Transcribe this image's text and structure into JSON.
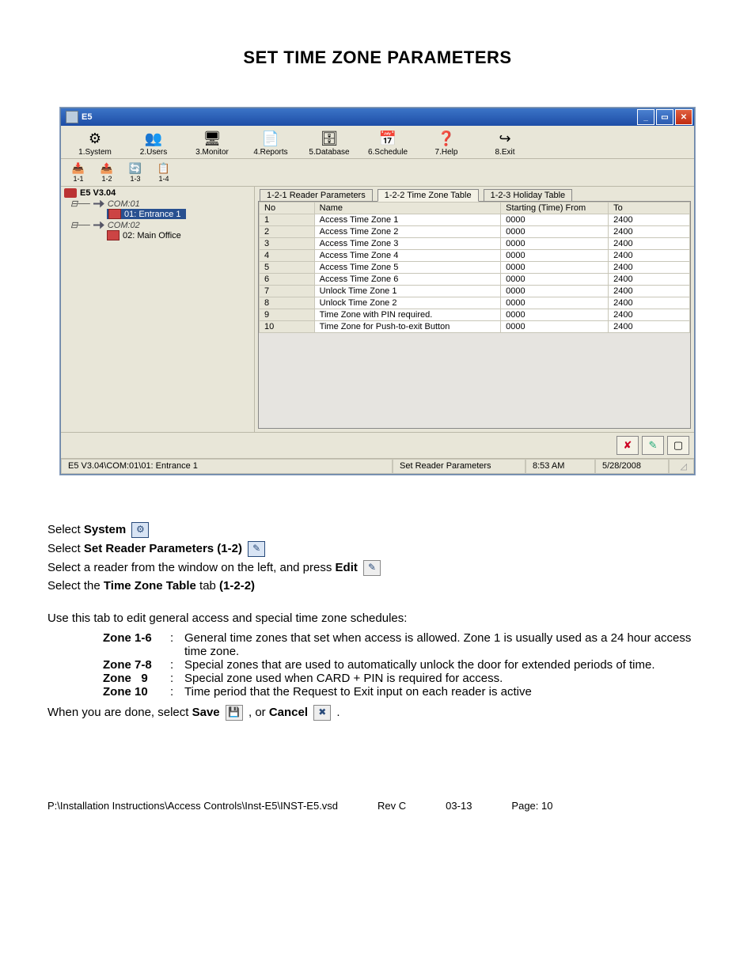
{
  "page_title": "SET TIME ZONE PARAMETERS",
  "window": {
    "title": "E5",
    "menu_items": [
      {
        "label": "1.System"
      },
      {
        "label": "2.Users"
      },
      {
        "label": "3.Monitor"
      },
      {
        "label": "4.Reports"
      },
      {
        "label": "5.Database"
      },
      {
        "label": "6.Schedule"
      },
      {
        "label": "7.Help"
      },
      {
        "label": "8.Exit"
      }
    ],
    "mini_buttons": [
      "1-1",
      "1-2",
      "1-3",
      "1-4"
    ],
    "tree": {
      "root": "E5 V3.04",
      "coms": [
        {
          "name": "COM:01",
          "leaves": [
            {
              "label": "01: Entrance 1",
              "selected": true
            }
          ]
        },
        {
          "name": "COM:02",
          "leaves": [
            {
              "label": "02: Main Office",
              "selected": false
            }
          ]
        }
      ]
    },
    "tabs": [
      {
        "label": "1-2-1 Reader Parameters",
        "active": false
      },
      {
        "label": "1-2-2 Time Zone Table",
        "active": true
      },
      {
        "label": "1-2-3 Holiday Table",
        "active": false
      }
    ],
    "grid": {
      "headers": [
        "No",
        "Name",
        "Starting (Time) From",
        "To"
      ],
      "rows": [
        {
          "no": "1",
          "name": "Access Time Zone 1",
          "from": "0000",
          "to": "2400"
        },
        {
          "no": "2",
          "name": "Access Time Zone 2",
          "from": "0000",
          "to": "2400"
        },
        {
          "no": "3",
          "name": "Access Time Zone 3",
          "from": "0000",
          "to": "2400"
        },
        {
          "no": "4",
          "name": "Access Time Zone 4",
          "from": "0000",
          "to": "2400"
        },
        {
          "no": "5",
          "name": "Access Time Zone 5",
          "from": "0000",
          "to": "2400"
        },
        {
          "no": "6",
          "name": "Access Time Zone 6",
          "from": "0000",
          "to": "2400"
        },
        {
          "no": "7",
          "name": "Unlock Time Zone 1",
          "from": "0000",
          "to": "2400"
        },
        {
          "no": "8",
          "name": "Unlock Time Zone 2",
          "from": "0000",
          "to": "2400"
        },
        {
          "no": "9",
          "name": "Time Zone with PIN required.",
          "from": "0000",
          "to": "2400"
        },
        {
          "no": "10",
          "name": "Time Zone for Push-to-exit Button",
          "from": "0000",
          "to": "2400"
        }
      ]
    },
    "status": {
      "path": "E5 V3.04\\COM:01\\01: Entrance 1",
      "mode": "Set Reader Parameters",
      "time": "8:53 AM",
      "date": "5/28/2008"
    }
  },
  "instructions": {
    "line1_a": "Select ",
    "line1_b": "System",
    "line2_a": "Select ",
    "line2_b": "Set Reader Parameters (1-2)",
    "line3_a": "Select a reader from the window on the left, and press ",
    "line3_b": "Edit",
    "line4_a": "Select the ",
    "line4_b": "Time Zone Table",
    "line4_c": " tab ",
    "line4_d": "(1-2-2)",
    "para": "Use this tab to edit general access and special time zone schedules:",
    "zones": [
      {
        "label": "Zone 1-6",
        "text": "General time zones that set when access is allowed.  Zone 1 is usually used as a 24 hour access time zone."
      },
      {
        "label": "Zone 7-8",
        "text": "Special zones that are used to automatically unlock the door for extended periods of time."
      },
      {
        "label": "Zone   9",
        "text": "Special zone used when CARD + PIN is required for access."
      },
      {
        "label": "Zone 10",
        "text": "Time period that the Request to Exit input on each reader is active"
      }
    ],
    "closing_a": "When you are done, select ",
    "closing_b": "Save",
    "closing_c": " , or ",
    "closing_d": "Cancel",
    "closing_e": " ."
  },
  "footer": {
    "path": "P:\\Installation Instructions\\Access Controls\\Inst-E5\\INST-E5.vsd",
    "rev": "Rev C",
    "date": "03-13",
    "page": "Page: 10"
  }
}
